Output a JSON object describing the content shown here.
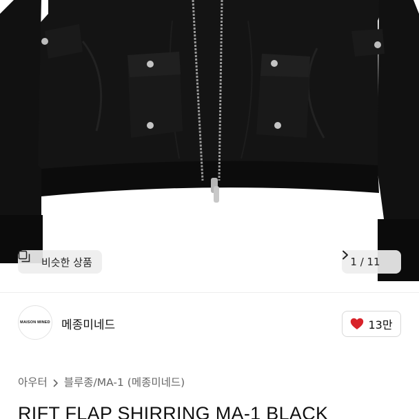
{
  "gallery": {
    "similar_label": "비슷한 상품",
    "page_current": "1",
    "page_sep": " / ",
    "page_total": "11"
  },
  "seller": {
    "logo_text": "MAISON MINED",
    "name": "메종미네드"
  },
  "like": {
    "count": "13만",
    "color": "#d8232a"
  },
  "breadcrumb": {
    "category": "아우터",
    "subcategory": "블루종/MA-1 (메종미네드)"
  },
  "product": {
    "title": "RIFT FLAP SHIRRING MA-1 BLACK"
  },
  "icons": {
    "similar": "similar-items-icon",
    "next": "chevron-right-icon",
    "like": "heart-icon",
    "crumb_sep": "chevron-right-icon"
  }
}
